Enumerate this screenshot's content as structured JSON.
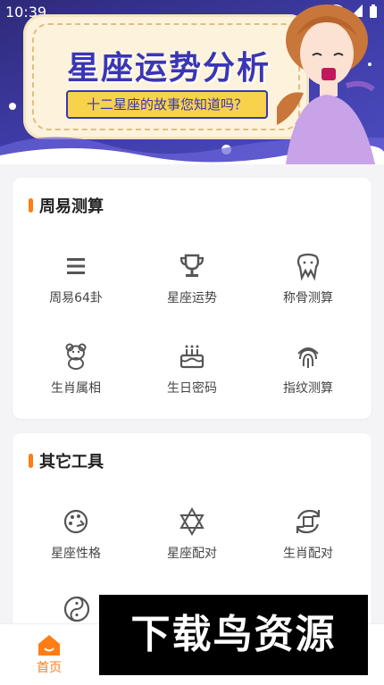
{
  "status": {
    "time": "10:39"
  },
  "banner": {
    "title": "星座运势分析",
    "subtitle": "十二星座的故事您知道吗？"
  },
  "section1": {
    "title": "周易测算",
    "items": [
      {
        "label": "周易64卦",
        "icon": "list-icon"
      },
      {
        "label": "星座运势",
        "icon": "trophy-icon"
      },
      {
        "label": "称骨测算",
        "icon": "tooth-icon"
      },
      {
        "label": "生肖属相",
        "icon": "bear-icon"
      },
      {
        "label": "生日密码",
        "icon": "cake-icon"
      },
      {
        "label": "指纹测算",
        "icon": "fingerprint-icon"
      }
    ]
  },
  "section2": {
    "title": "其它工具",
    "items": [
      {
        "label": "星座性格",
        "icon": "palette-icon"
      },
      {
        "label": "星座配对",
        "icon": "star-of-david-icon"
      },
      {
        "label": "生肖配对",
        "icon": "sync-icon"
      }
    ]
  },
  "tabbar": {
    "home_label": "首页"
  },
  "watermark": {
    "text": "下载鸟资源"
  },
  "colors": {
    "accent": "#ff7d14",
    "banner": "#3d3aa3"
  }
}
